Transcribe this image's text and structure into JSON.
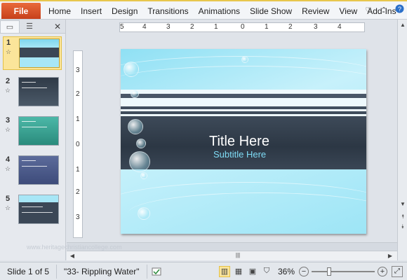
{
  "ribbon": {
    "file_label": "File",
    "tabs": [
      "Home",
      "Insert",
      "Design",
      "Transitions",
      "Animations",
      "Slide Show",
      "Review",
      "View",
      "Add-Ins"
    ],
    "right_icons": [
      "heart-icon",
      "minimize-ribbon-icon",
      "help-icon"
    ]
  },
  "left_panel": {
    "tabs": [
      "slides-tab-icon",
      "outline-tab-icon"
    ],
    "close_icon": "close-icon",
    "thumbnails": [
      {
        "number": "1",
        "selected": true
      },
      {
        "number": "2",
        "selected": false
      },
      {
        "number": "3",
        "selected": false
      },
      {
        "number": "4",
        "selected": false
      },
      {
        "number": "5",
        "selected": false
      }
    ]
  },
  "rulers": {
    "horizontal": [
      "5",
      "4",
      "3",
      "2",
      "1",
      "0",
      "1",
      "2",
      "3",
      "4"
    ],
    "vertical": [
      "3",
      "2",
      "1",
      "0",
      "1",
      "2",
      "3"
    ]
  },
  "slide": {
    "title": "Title Here",
    "subtitle": "Subtitle Here"
  },
  "watermark": "www.heritagechristiancollege.com",
  "status": {
    "slide_indicator": "Slide 1 of 5",
    "theme": "\"33- Rippling Water\"",
    "zoom": "36%",
    "view_icons": [
      "normal-view-icon",
      "slide-sorter-icon",
      "reading-view-icon",
      "slideshow-icon"
    ]
  },
  "colors": {
    "file_tab": "#d4532a",
    "accent_selection": "#fbe59a",
    "slide_light": "#a7e6f6",
    "slide_dark": "#2c3744",
    "subtitle": "#7fdcf6"
  }
}
